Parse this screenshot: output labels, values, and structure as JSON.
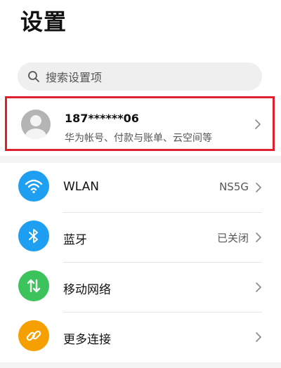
{
  "header": {
    "title": "设置"
  },
  "search": {
    "placeholder": "搜索设置项"
  },
  "account": {
    "phone": "187******06",
    "description": "华为帐号、付款与账单、云空间等"
  },
  "items": [
    {
      "label": "WLAN",
      "value": "NS5G",
      "icon": "wifi-icon",
      "color": "#1e9ff2"
    },
    {
      "label": "蓝牙",
      "value": "已关闭",
      "icon": "bluetooth-icon",
      "color": "#1e9ff2"
    },
    {
      "label": "移动网络",
      "value": "",
      "icon": "mobile-data-icon",
      "color": "#3cc35b"
    },
    {
      "label": "更多连接",
      "value": "",
      "icon": "link-icon",
      "color": "#f5a000"
    }
  ],
  "highlight_color": "#e0202c"
}
